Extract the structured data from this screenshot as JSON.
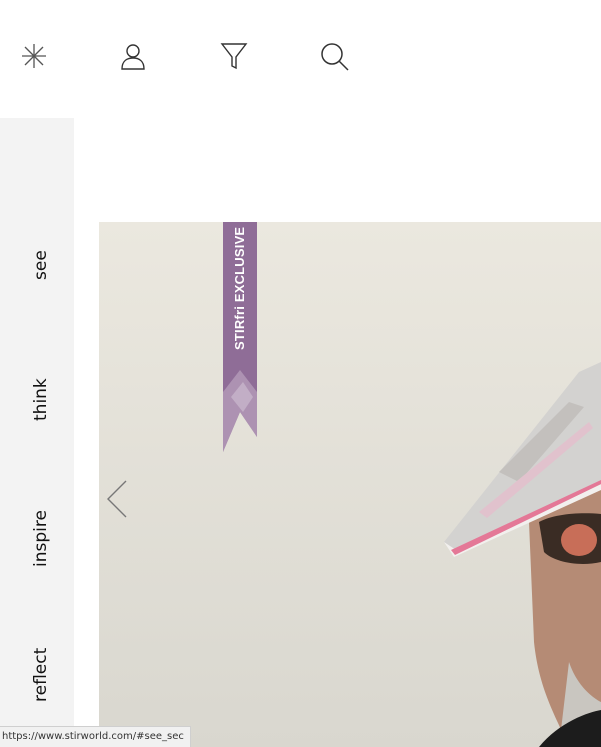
{
  "topbar": {
    "icons": [
      "sparkle-icon",
      "user-icon",
      "filter-icon",
      "search-icon"
    ]
  },
  "sidenav": {
    "items": [
      {
        "label": "see"
      },
      {
        "label": "think"
      },
      {
        "label": "inspire"
      },
      {
        "label": "reflect"
      }
    ]
  },
  "hero": {
    "ribbon_text": "STIRfri EXCLUSIVE",
    "ribbon_color": "#8f6d97",
    "prev_icon": "chevron-left-icon"
  },
  "status": {
    "url": "https://www.stirworld.com/#see_sec"
  }
}
